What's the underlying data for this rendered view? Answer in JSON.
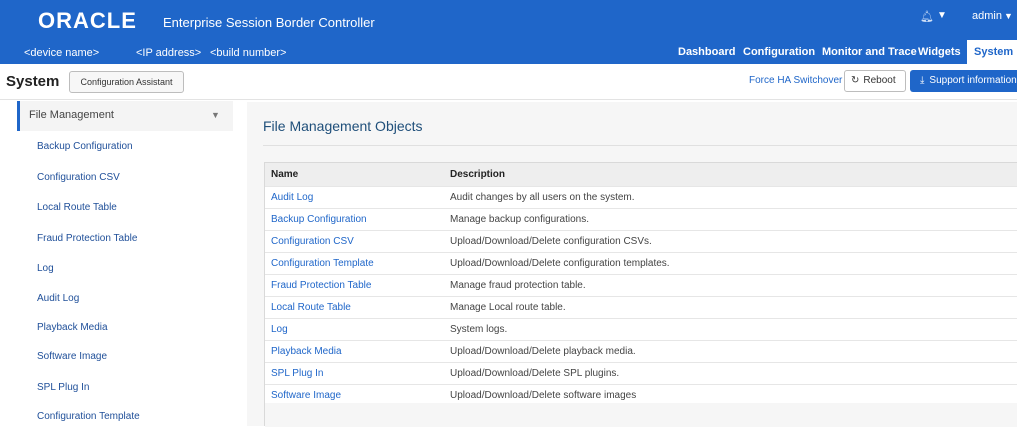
{
  "header": {
    "logo": "ORACLE",
    "product": "Enterprise Session Border Controller",
    "device": "<device name>",
    "ip": "<IP address>",
    "build": "<build number>",
    "user": "admin",
    "nav_tabs": [
      "Dashboard",
      "Configuration",
      "Monitor and Trace",
      "Widgets",
      "System"
    ],
    "active_tab": "System",
    "accent_color": "#1f66c9"
  },
  "toolbar": {
    "title": "System",
    "config_assistant": "Configuration Assistant",
    "force_ha": "Force HA Switchover",
    "reboot": "Reboot",
    "support": "Support information"
  },
  "sidebar": {
    "section": "File Management",
    "items": [
      "Backup Configuration",
      "Configuration CSV",
      "Local Route Table",
      "Fraud Protection Table",
      "Log",
      "Audit Log",
      "Playback Media",
      "Software Image",
      "SPL Plug In",
      "Configuration Template"
    ]
  },
  "main": {
    "title": "File Management Objects",
    "columns": [
      "Name",
      "Description"
    ],
    "rows": [
      {
        "name": "Audit Log",
        "description": "Audit changes by all users on the system."
      },
      {
        "name": "Backup Configuration",
        "description": "Manage backup configurations."
      },
      {
        "name": "Configuration CSV",
        "description": "Upload/Download/Delete configuration CSVs."
      },
      {
        "name": "Configuration Template",
        "description": "Upload/Download/Delete configuration templates."
      },
      {
        "name": "Fraud Protection Table",
        "description": "Manage fraud protection table."
      },
      {
        "name": "Local Route Table",
        "description": "Manage Local route table."
      },
      {
        "name": "Log",
        "description": "System logs."
      },
      {
        "name": "Playback Media",
        "description": "Upload/Download/Delete playback media."
      },
      {
        "name": "SPL Plug In",
        "description": "Upload/Download/Delete SPL plugins."
      },
      {
        "name": "Software Image",
        "description": "Upload/Download/Delete software images"
      }
    ]
  }
}
